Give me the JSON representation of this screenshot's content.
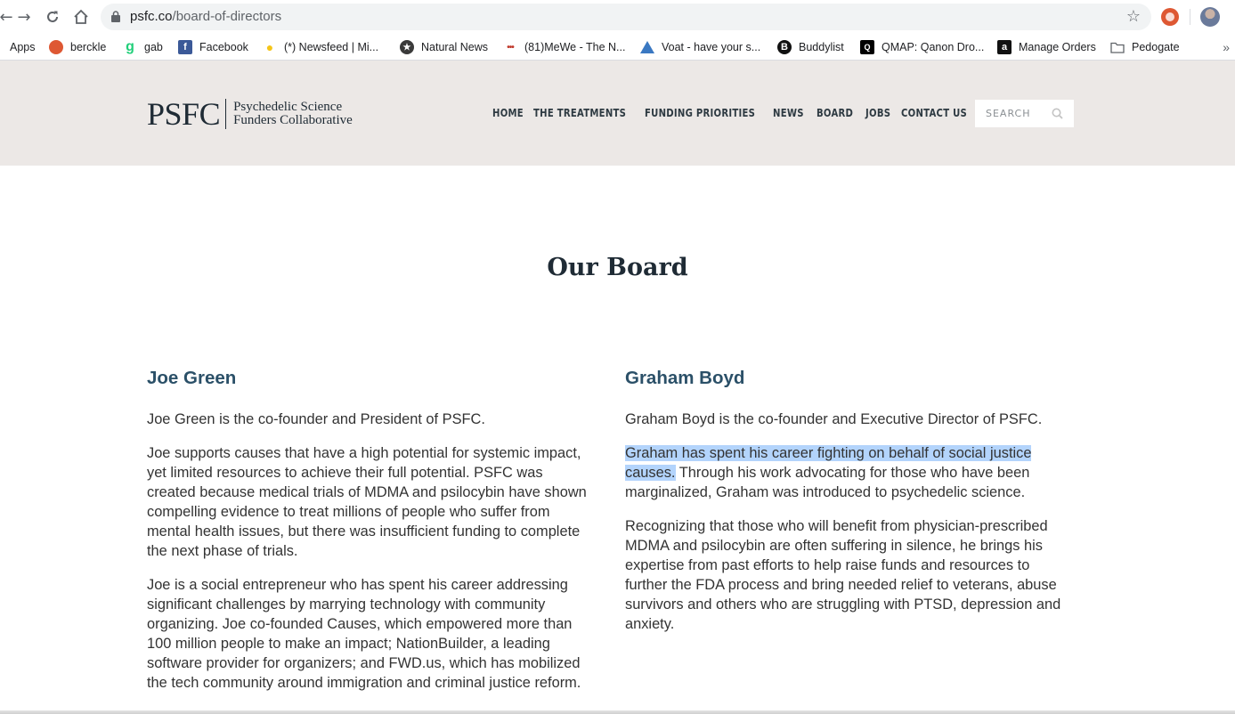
{
  "browser": {
    "url_host": "psfc.co",
    "url_path": "/board-of-directors",
    "bookmarks": [
      {
        "label": "Apps",
        "icon": "apps-grid-icon"
      },
      {
        "label": "berckle",
        "icon": "duckduckgo-icon"
      },
      {
        "label": "gab",
        "icon": "gab-icon"
      },
      {
        "label": "Facebook",
        "icon": "facebook-icon"
      },
      {
        "label": "(*) Newsfeed | Mi...",
        "icon": "lightbulb-icon"
      },
      {
        "label": "Natural News",
        "icon": "star-badge-icon"
      },
      {
        "label": "(81)MeWe - The N...",
        "icon": "mewe-dots-icon"
      },
      {
        "label": "Voat - have your s...",
        "icon": "voat-triangle-icon"
      },
      {
        "label": "Buddylist",
        "icon": "buddylist-icon"
      },
      {
        "label": "QMAP: Qanon Dro...",
        "icon": "qmap-icon"
      },
      {
        "label": "Manage Orders",
        "icon": "amazon-icon"
      },
      {
        "label": "Pedogate",
        "icon": "folder-icon"
      }
    ]
  },
  "site": {
    "logo_mark": "PSFC",
    "logo_line1": "Psychedelic Science",
    "logo_line2": "Funders Collaborative",
    "nav": [
      "HOME",
      "THE TREATMENTS",
      "FUNDING PRIORITIES",
      "NEWS",
      "BOARD",
      "JOBS",
      "CONTACT US"
    ],
    "search_placeholder": "SEARCH"
  },
  "page": {
    "title": "Our Board",
    "members": [
      {
        "name": "Joe Green",
        "paragraphs": [
          "Joe Green is the co-founder and President of PSFC.",
          "Joe supports causes that have a high potential for systemic impact, yet limited resources to achieve their full potential. PSFC was created because medical trials of MDMA and psilocybin have shown compelling evidence to treat millions of people who suffer from mental health issues, but there was insufficient funding to complete the next phase of trials.",
          "Joe is a social entrepreneur who has spent his career addressing significant challenges by marrying technology with community organizing. Joe co-founded Causes, which empowered more than 100 million people to make an impact; NationBuilder, a leading software provider for organizers; and FWD.us, which has mobilized the tech community around immigration and criminal justice reform."
        ]
      },
      {
        "name": "Graham Boyd",
        "p1": "Graham Boyd is the co-founder and Executive Director of PSFC.",
        "p2_highlight": "Graham has spent his career fighting on behalf of social justice causes.",
        "p2_rest": " Through his work advocating for those who have been marginalized, Graham was introduced to psychedelic science.",
        "p3": "Recognizing that those who will benefit from physician-prescribed MDMA and psilocybin are often suffering in silence, he brings his expertise from past efforts to help raise funds and resources to further the FDA process and bring needed relief to veterans, abuse survivors and others who are struggling with PTSD, depression and anxiety."
      }
    ]
  }
}
